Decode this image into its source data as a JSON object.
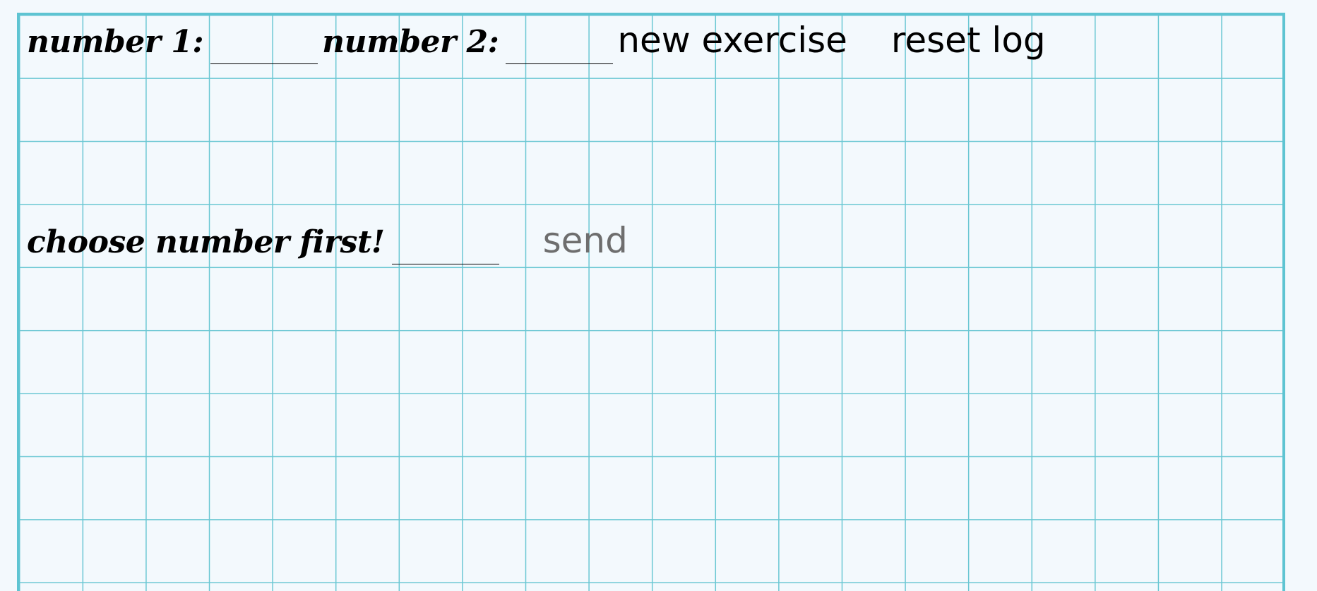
{
  "controls": {
    "number1_label": "number 1:",
    "number1_value": "",
    "number2_label": "number 2:",
    "number2_value": "",
    "new_exercise_label": "new exercise",
    "reset_log_label": "reset log"
  },
  "answer": {
    "prompt": "choose number first!",
    "value": "",
    "send_label": "send"
  },
  "colors": {
    "background": "#f3f9fd",
    "grid": "#6ac7d3",
    "border": "#5ec4d2",
    "send_disabled": "#6e6e6e"
  }
}
